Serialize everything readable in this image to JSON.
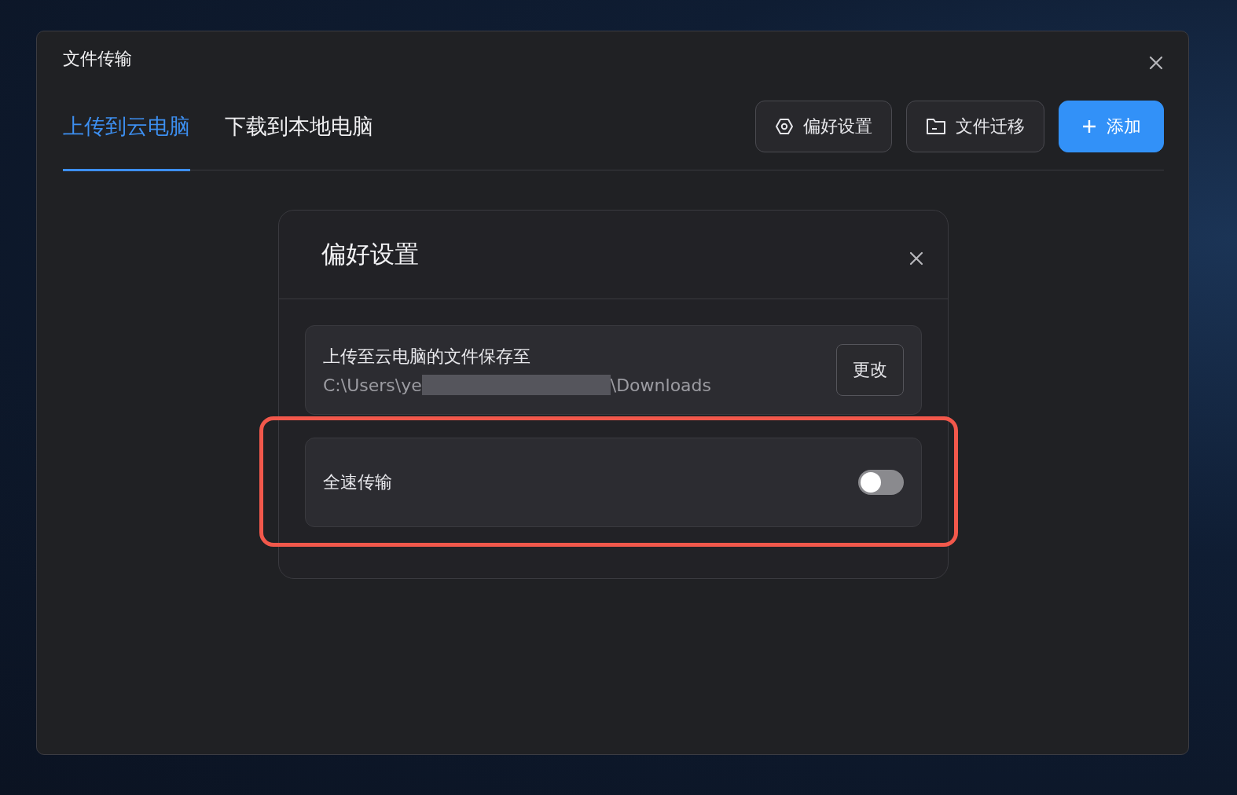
{
  "window": {
    "title": "文件传输"
  },
  "tabs": [
    {
      "label": "上传到云电脑",
      "selected": true
    },
    {
      "label": "下载到本地电脑",
      "selected": false
    }
  ],
  "toolbar_buttons": [
    {
      "kind": "settings",
      "label": "偏好设置",
      "primary": false
    },
    {
      "kind": "folder",
      "label": "文件迁移",
      "primary": false
    },
    {
      "kind": "add",
      "label": "添加",
      "primary": true
    }
  ],
  "dialog": {
    "title": "偏好设置",
    "settings": [
      {
        "kind": "path",
        "label": "上传至云电脑的文件保存至",
        "path_start": "C:\\Users\\ye",
        "path_end": "\\Downloads",
        "redacted": true,
        "button": "更改",
        "highlighted": false
      },
      {
        "kind": "switch",
        "label": "全速传输",
        "on": false,
        "highlighted": true
      }
    ]
  }
}
